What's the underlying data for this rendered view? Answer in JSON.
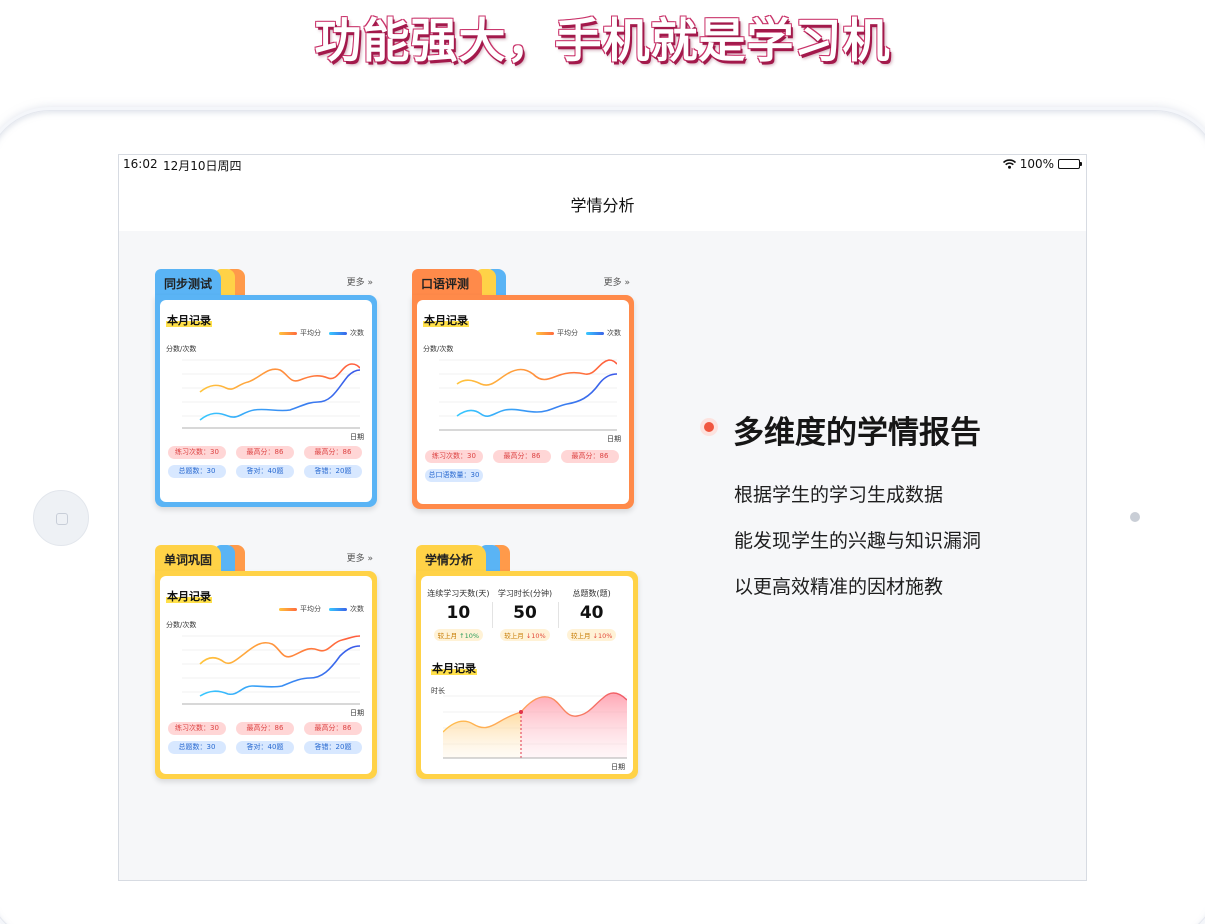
{
  "headline": "功能强大，手机就是学习机",
  "status": {
    "time": "16:02",
    "date": "12月10日周四",
    "battery": "100%"
  },
  "nav": {
    "title": "学情分析"
  },
  "colors": {
    "blue": "#5ab4f5",
    "orange": "#ff8a4a",
    "yellow": "#ffd247",
    "accent_red": "#f0563f"
  },
  "cards": {
    "sync": {
      "tab": "同步测试",
      "more": "更多",
      "record_title": "本月记录",
      "legend": [
        "平均分",
        "次数"
      ],
      "ylabel": "分数/次数",
      "xlabel": "日期",
      "pills_row1": [
        "练习次数：30",
        "最高分：86",
        "最高分：86"
      ],
      "pills_row2": [
        "总题数：30",
        "答对：40题",
        "答错：20题"
      ]
    },
    "oral": {
      "tab": "口语评测",
      "more": "更多",
      "record_title": "本月记录",
      "legend": [
        "平均分",
        "次数"
      ],
      "ylabel": "分数/次数",
      "xlabel": "日期",
      "pills_row1": [
        "练习次数：30",
        "最高分：86",
        "最高分：86"
      ],
      "pills_row2": [
        "总口语数量：30"
      ]
    },
    "words": {
      "tab": "单词巩固",
      "more": "更多",
      "record_title": "本月记录",
      "legend": [
        "平均分",
        "次数"
      ],
      "ylabel": "分数/次数",
      "xlabel": "日期",
      "pills_row1": [
        "练习次数：30",
        "最高分：86",
        "最高分：86"
      ],
      "pills_row2": [
        "总题数：30",
        "答对：40题",
        "答错：20题"
      ]
    },
    "analysis": {
      "tab": "学情分析",
      "stats": [
        {
          "label": "连续学习天数(天)",
          "value": "10",
          "cmp": "较上月",
          "delta": "↑10%"
        },
        {
          "label": "学习时长(分钟)",
          "value": "50",
          "cmp": "较上月",
          "delta": "↓10%"
        },
        {
          "label": "总题数(题)",
          "value": "40",
          "cmp": "较上月",
          "delta": "↓10%"
        }
      ],
      "record_title": "本月记录",
      "ylabel": "时长",
      "xlabel": "日期"
    }
  },
  "feature": {
    "title": "多维度的学情报告",
    "lines": [
      "根据学生的学习生成数据",
      "能发现学生的兴趣与知识漏洞",
      "以更高效精准的因材施教"
    ]
  }
}
